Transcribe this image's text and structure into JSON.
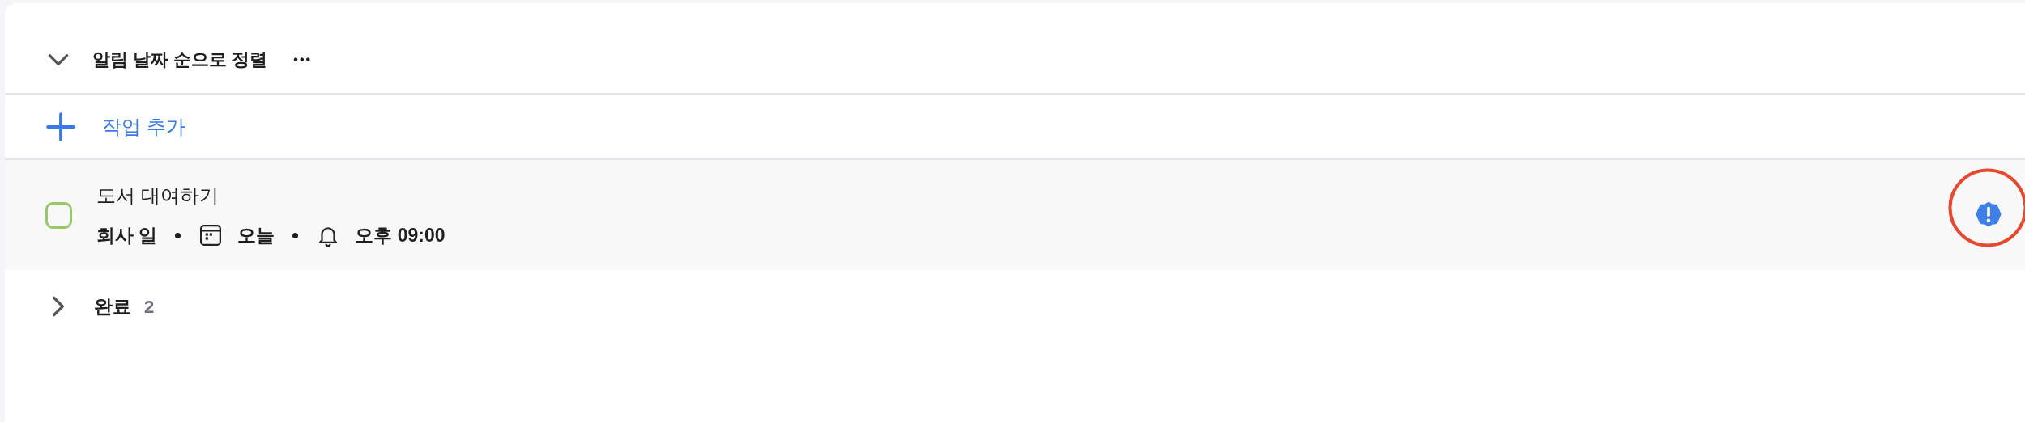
{
  "header": {
    "expanded": true,
    "sort_label": "알림 날짜 순으로 정렬",
    "more": "•••"
  },
  "add_task": {
    "label": "작업 추가"
  },
  "tasks": [
    {
      "title": "도서 대여하기",
      "checked": false,
      "list": "회사 일",
      "date": "오늘",
      "reminder": "오후 09:00",
      "important": true
    }
  ],
  "completed": {
    "label": "완료",
    "count": "2",
    "expanded": false
  }
}
